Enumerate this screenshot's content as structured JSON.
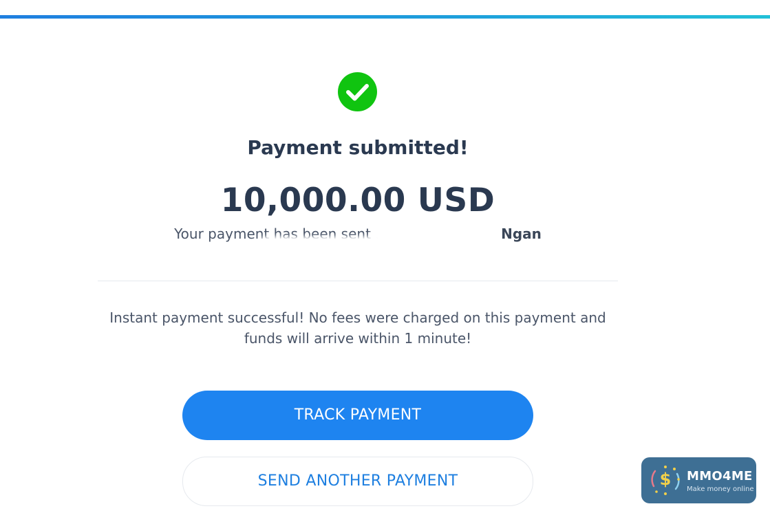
{
  "header": {
    "accent_color": "#1e84f0"
  },
  "status": {
    "icon": "check-circle-icon",
    "icon_color": "#10c410",
    "title": "Payment submitted!"
  },
  "payment": {
    "amount": "10,000.00 USD",
    "recipient_prefix": "Your payment has been sent to",
    "recipient_name": "Ngan"
  },
  "notice": {
    "text": "Instant payment successful! No fees were charged on this payment and funds will arrive within 1 minute!"
  },
  "actions": {
    "track_label": "TRACK PAYMENT",
    "send_another_label": "SEND ANOTHER PAYMENT"
  },
  "watermark": {
    "brand": "MMO4ME",
    "tagline": "Make money online",
    "icon": "dollar-coin-icon"
  }
}
